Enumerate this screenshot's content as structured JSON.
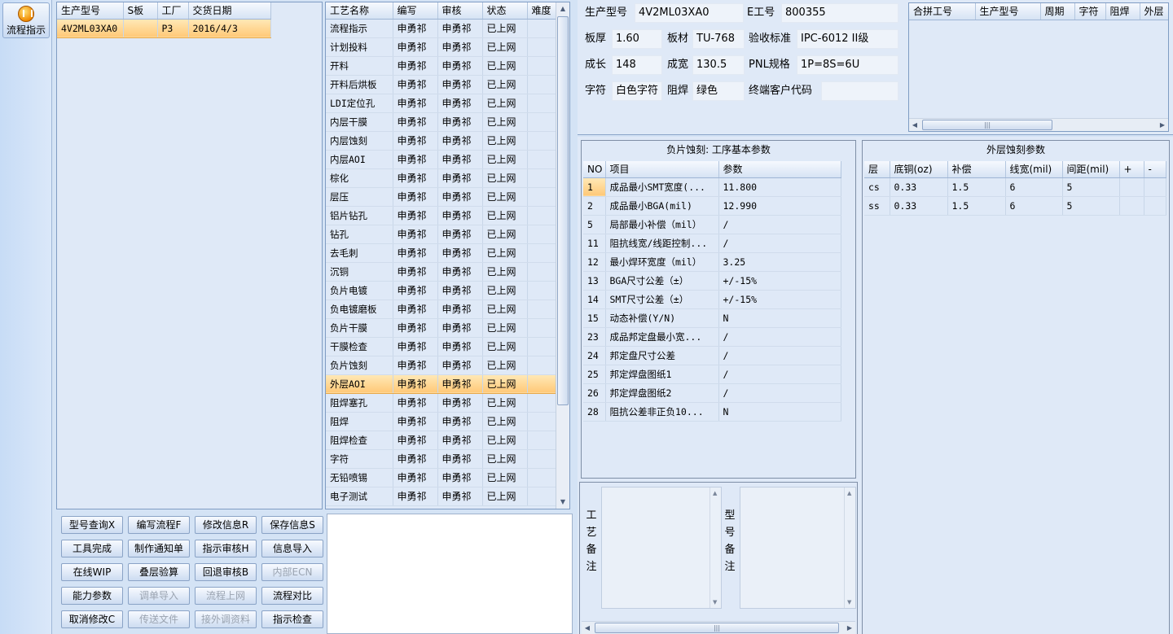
{
  "toolbar": {
    "flow_button": "流程指示"
  },
  "model_grid": {
    "headers": [
      "生产型号",
      "S板",
      "工厂",
      "交货日期"
    ],
    "rows": [
      [
        "4V2ML03XA0",
        "",
        "P3",
        "2016/4/3"
      ]
    ]
  },
  "process_grid": {
    "headers": [
      "工艺名称",
      "编写",
      "审核",
      "状态",
      "难度"
    ],
    "selected_index": 19,
    "rows": [
      [
        "流程指示",
        "申勇祁",
        "申勇祁",
        "已上网",
        ""
      ],
      [
        "计划投料",
        "申勇祁",
        "申勇祁",
        "已上网",
        ""
      ],
      [
        "开料",
        "申勇祁",
        "申勇祁",
        "已上网",
        ""
      ],
      [
        "开料后烘板",
        "申勇祁",
        "申勇祁",
        "已上网",
        ""
      ],
      [
        "LDI定位孔",
        "申勇祁",
        "申勇祁",
        "已上网",
        ""
      ],
      [
        "内层干膜",
        "申勇祁",
        "申勇祁",
        "已上网",
        ""
      ],
      [
        "内层蚀刻",
        "申勇祁",
        "申勇祁",
        "已上网",
        ""
      ],
      [
        "内层AOI",
        "申勇祁",
        "申勇祁",
        "已上网",
        ""
      ],
      [
        "棕化",
        "申勇祁",
        "申勇祁",
        "已上网",
        ""
      ],
      [
        "层压",
        "申勇祁",
        "申勇祁",
        "已上网",
        ""
      ],
      [
        "铝片钻孔",
        "申勇祁",
        "申勇祁",
        "已上网",
        ""
      ],
      [
        "钻孔",
        "申勇祁",
        "申勇祁",
        "已上网",
        ""
      ],
      [
        "去毛刺",
        "申勇祁",
        "申勇祁",
        "已上网",
        ""
      ],
      [
        "沉铜",
        "申勇祁",
        "申勇祁",
        "已上网",
        ""
      ],
      [
        "负片电镀",
        "申勇祁",
        "申勇祁",
        "已上网",
        ""
      ],
      [
        "负电镀磨板",
        "申勇祁",
        "申勇祁",
        "已上网",
        ""
      ],
      [
        "负片干膜",
        "申勇祁",
        "申勇祁",
        "已上网",
        ""
      ],
      [
        "干膜检查",
        "申勇祁",
        "申勇祁",
        "已上网",
        ""
      ],
      [
        "负片蚀刻",
        "申勇祁",
        "申勇祁",
        "已上网",
        ""
      ],
      [
        "外层AOI",
        "申勇祁",
        "申勇祁",
        "已上网",
        ""
      ],
      [
        "阻焊塞孔",
        "申勇祁",
        "申勇祁",
        "已上网",
        ""
      ],
      [
        "阻焊",
        "申勇祁",
        "申勇祁",
        "已上网",
        ""
      ],
      [
        "阻焊检查",
        "申勇祁",
        "申勇祁",
        "已上网",
        ""
      ],
      [
        "字符",
        "申勇祁",
        "申勇祁",
        "已上网",
        ""
      ],
      [
        "无铅喷锡",
        "申勇祁",
        "申勇祁",
        "已上网",
        ""
      ],
      [
        "电子测试",
        "申勇祁",
        "申勇祁",
        "已上网",
        ""
      ]
    ]
  },
  "buttons": [
    {
      "label": "型号查询X",
      "enabled": true
    },
    {
      "label": "编写流程F",
      "enabled": true
    },
    {
      "label": "修改信息R",
      "enabled": true
    },
    {
      "label": "保存信息S",
      "enabled": true
    },
    {
      "label": "工具完成",
      "enabled": true
    },
    {
      "label": "制作通知单",
      "enabled": true
    },
    {
      "label": "指示审核H",
      "enabled": true
    },
    {
      "label": "信息导入",
      "enabled": true
    },
    {
      "label": "在线WIP",
      "enabled": true
    },
    {
      "label": "叠层验算",
      "enabled": true
    },
    {
      "label": "回退审核B",
      "enabled": true
    },
    {
      "label": "内部ECN",
      "enabled": false
    },
    {
      "label": "能力参数",
      "enabled": true
    },
    {
      "label": "调单导入",
      "enabled": false
    },
    {
      "label": "流程上网",
      "enabled": false
    },
    {
      "label": "流程对比",
      "enabled": true
    },
    {
      "label": "取消修改C",
      "enabled": true
    },
    {
      "label": "传送文件",
      "enabled": false
    },
    {
      "label": "接外调资料",
      "enabled": false
    },
    {
      "label": "指示检查",
      "enabled": true
    }
  ],
  "info": {
    "model_label": "生产型号",
    "model_value": "4V2ML03XA0",
    "e_label": "E工号",
    "e_value": "800355",
    "thickness_label": "板厚",
    "thickness_value": "1.60",
    "material_label": "板材",
    "material_value": "TU-768",
    "standard_label": "验收标准",
    "standard_value": "IPC-6012 II级",
    "length_label": "成长",
    "length_value": "148",
    "width_label": "成宽",
    "width_value": "130.5",
    "pnl_label": "PNL规格",
    "pnl_value": "1P=8S=6U",
    "char_label": "字符",
    "char_value": "白色字符",
    "mask_label": "阻焊",
    "mask_value": "绿色",
    "customer_label": "终端客户代码",
    "customer_value": ""
  },
  "combined_grid": {
    "headers": [
      "合拼工号",
      "生产型号",
      "周期",
      "字符",
      "阻焊",
      "外层"
    ]
  },
  "params_box": {
    "title": "负片蚀刻: 工序基本参数",
    "headers": [
      "NO",
      "项目",
      "参数"
    ],
    "rows": [
      [
        "1",
        "成品最小SMT宽度(...",
        "11.800"
      ],
      [
        "2",
        "成品最小BGA(mil)",
        "12.990"
      ],
      [
        "5",
        "局部最小补偿（mil）",
        "/"
      ],
      [
        "11",
        "阻抗线宽/线距控制...",
        "/"
      ],
      [
        "12",
        "最小焊环宽度（mil）",
        "3.25"
      ],
      [
        "13",
        "BGA尺寸公差（±）",
        "+/-15%"
      ],
      [
        "14",
        "SMT尺寸公差（±）",
        "+/-15%"
      ],
      [
        "15",
        "动态补偿(Y/N)",
        "N"
      ],
      [
        "23",
        "成品邦定盘最小宽...",
        "/"
      ],
      [
        "24",
        "邦定盘尺寸公差",
        "/"
      ],
      [
        "25",
        "邦定焊盘图纸1",
        "/"
      ],
      [
        "26",
        "邦定焊盘图纸2",
        "/"
      ],
      [
        "28",
        "阻抗公差非正负10...",
        "N"
      ]
    ]
  },
  "outer_box": {
    "title": "外层蚀刻参数",
    "headers": [
      "层",
      "底铜(oz)",
      "补偿",
      "线宽(mil)",
      "间距(mil)",
      "+",
      "-"
    ],
    "rows": [
      [
        "cs",
        "0.33",
        "1.5",
        "6",
        "5",
        "",
        ""
      ],
      [
        "ss",
        "0.33",
        "1.5",
        "6",
        "5",
        "",
        ""
      ]
    ]
  },
  "notes": {
    "process_label": "工艺备注",
    "model_label": "型号备注"
  }
}
